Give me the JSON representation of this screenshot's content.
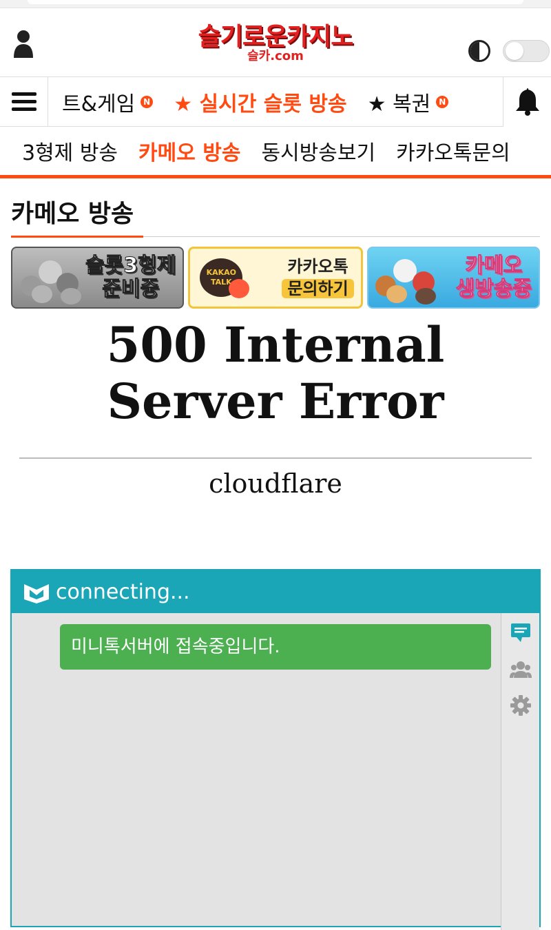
{
  "header": {
    "logo_main": "슬기로운카지노",
    "logo_sub": "슬카.com"
  },
  "nav": {
    "items": [
      {
        "label": "트&게임",
        "badge": "N",
        "hot": false
      },
      {
        "label": "★ 실시간 슬롯 방송",
        "badge": "",
        "hot": true
      },
      {
        "label": "★ 복권",
        "badge": "N",
        "hot": false
      }
    ]
  },
  "subnav": {
    "items": [
      "3형제 방송",
      "카메오 방송",
      "동시방송보기",
      "카카오톡문의"
    ],
    "active": "카메오 방송"
  },
  "section": {
    "title": "카메오 방송"
  },
  "banners": [
    {
      "line1": "슬롯3형제",
      "line2": "준비중"
    },
    {
      "badge": "KAKAO TALK",
      "line1": "카카오톡",
      "line2": "문의하기"
    },
    {
      "line1": "카메오",
      "line2": "생방송중"
    }
  ],
  "error": {
    "title": "500 Internal Server Error",
    "server": "cloudflare"
  },
  "chat": {
    "status": "connecting...",
    "message": "미니톡서버에 접속중입니다."
  },
  "colors": {
    "accent": "#ff4a12",
    "chat_header": "#1aa6b7",
    "chat_message": "#4caf50"
  }
}
